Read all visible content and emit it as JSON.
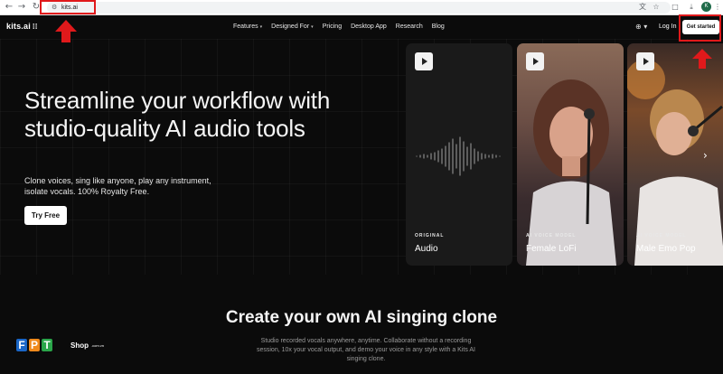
{
  "browser": {
    "url": "kits.ai",
    "icons": [
      "back-icon",
      "forward-icon",
      "reload-icon",
      "site-settings-icon",
      "translate-icon",
      "bookmark-star-icon",
      "extensions-icon",
      "download-icon",
      "profile-avatar",
      "menu-icon"
    ],
    "profile_initial": "K"
  },
  "header": {
    "logo_text": "kits.ai",
    "logo_mark": "⁞⁞",
    "nav": [
      {
        "label": "Features",
        "has_dropdown": true
      },
      {
        "label": "Designed For",
        "has_dropdown": true
      },
      {
        "label": "Pricing",
        "has_dropdown": false
      },
      {
        "label": "Desktop App",
        "has_dropdown": false
      },
      {
        "label": "Research",
        "has_dropdown": false
      },
      {
        "label": "Blog",
        "has_dropdown": false
      }
    ],
    "login": "Log In",
    "cta": "Get started"
  },
  "hero": {
    "title": "Streamline your workflow with studio-quality AI audio tools",
    "subtitle": "Clone voices, sing like anyone, play any instrument, isolate vocals. 100% Royalty Free.",
    "button": "Try Free"
  },
  "cards": [
    {
      "kicker": "ORIGINAL",
      "title": "Audio"
    },
    {
      "kicker": "AI VOICE MODEL",
      "title": "Female LoFi"
    },
    {
      "kicker": "AI VOICE MODEL",
      "title": "Male Emo Pop"
    }
  ],
  "section2": {
    "title": "Create your own AI singing clone",
    "body": "Studio recorded vocals anywhere, anytime. Collaborate without a recording session, 10x your vocal output, and demo your voice in any style with a Kits AI singing clone."
  },
  "watermark": {
    "letters": [
      "F",
      "P",
      "T"
    ],
    "shop": "Shop",
    "domain": ".com.vn"
  },
  "colors": {
    "background": "#0b0b0b",
    "annotation": "#e0191b",
    "cta_bg": "#ffffff"
  }
}
